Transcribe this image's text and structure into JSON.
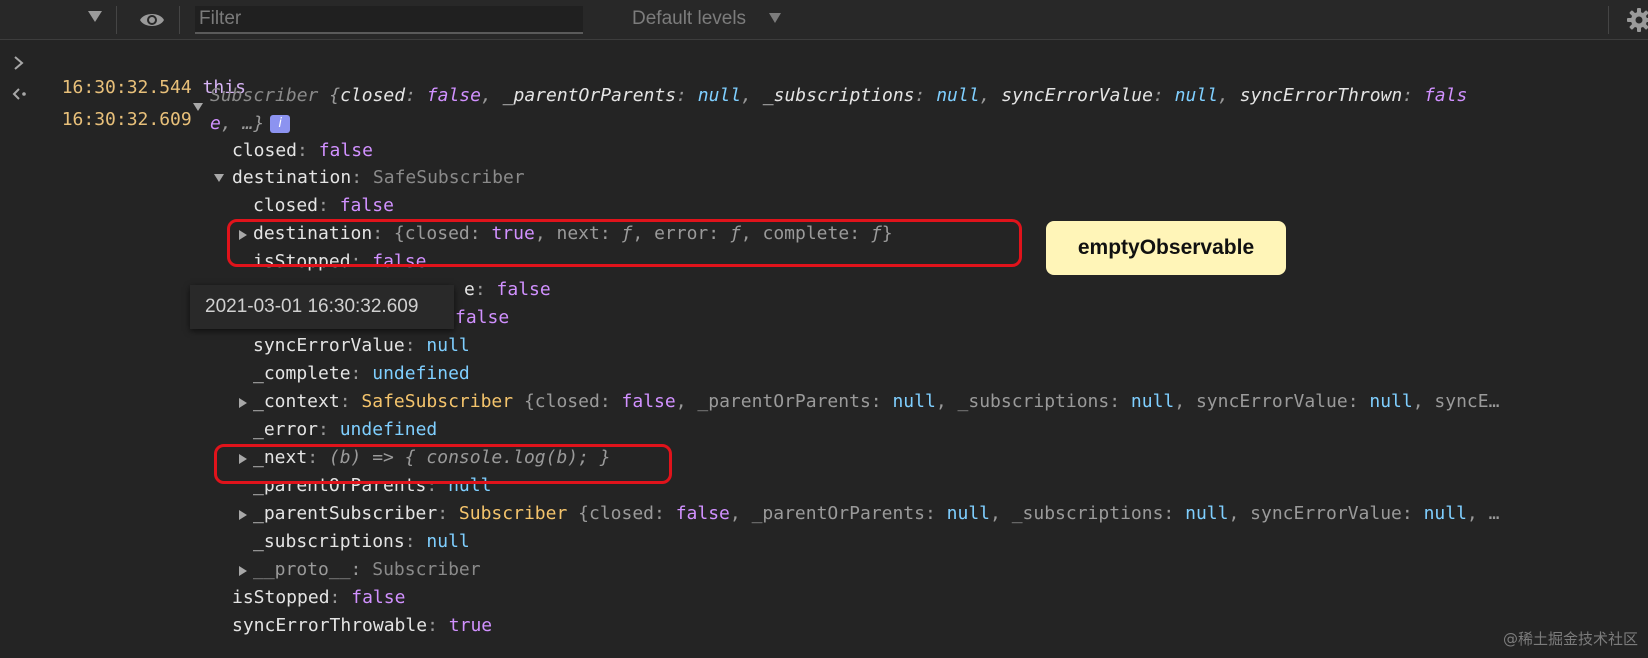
{
  "toolbar": {
    "filter_placeholder": "Filter",
    "levels_label": "Default levels",
    "icons": [
      "chevron-down-icon",
      "eye-icon",
      "gear-icon"
    ]
  },
  "entries": [
    {
      "direction": "input",
      "timestamp": "16:30:32.544",
      "text": "this"
    },
    {
      "direction": "output",
      "timestamp": "16:30:32.609"
    }
  ],
  "summary": {
    "class_name": "Subscriber",
    "open": " {",
    "props": [
      {
        "key": "closed",
        "value": "false"
      },
      {
        "key": "_parentOrParents",
        "value": "null"
      },
      {
        "key": "_subscriptions",
        "value": "null"
      },
      {
        "key": "syncErrorValue",
        "value": "null"
      },
      {
        "key": "syncErrorThrown",
        "value": "fals"
      }
    ],
    "wrap_value": "e",
    "tail": ", …}",
    "info_badge": "i"
  },
  "tree": {
    "closed": {
      "key": "closed",
      "value": "false"
    },
    "destination": {
      "key": "destination",
      "value": "SafeSubscriber"
    },
    "dest_closed": {
      "key": "closed",
      "value": "false"
    },
    "dest_destination": {
      "key": "destination",
      "props": [
        {
          "key": "closed",
          "value": "true"
        },
        {
          "key": "next",
          "value": "ƒ"
        },
        {
          "key": "error",
          "value": "ƒ"
        },
        {
          "key": "complete",
          "value": "ƒ"
        }
      ]
    },
    "dest_isStopped": {
      "key": "isStopped",
      "value": "false"
    },
    "dest_row_a": {
      "key_tail": "e",
      "value": "false"
    },
    "dest_row_b": {
      "value": "false"
    },
    "dest_syncErrorValue": {
      "key": "syncErrorValue",
      "value": "null"
    },
    "dest_complete": {
      "key": "_complete",
      "value": "undefined"
    },
    "dest_context": {
      "key": "_context",
      "class_name": "SafeSubscriber",
      "props": [
        {
          "key": "closed",
          "value": "false"
        },
        {
          "key": "_parentOrParents",
          "value": "null"
        },
        {
          "key": "_subscriptions",
          "value": "null"
        },
        {
          "key": "syncErrorValue",
          "value": "null"
        }
      ],
      "tail": ", syncE…"
    },
    "dest_error": {
      "key": "_error",
      "value": "undefined"
    },
    "dest_next": {
      "key": "_next",
      "value": "(b) => { console.log(b); }"
    },
    "dest_parentOrParents": {
      "key": "_parentOrParents",
      "value": "null"
    },
    "dest_parentSubscriber": {
      "key": "_parentSubscriber",
      "class_name": "Subscriber",
      "props": [
        {
          "key": "closed",
          "value": "false"
        },
        {
          "key": "_parentOrParents",
          "value": "null"
        },
        {
          "key": "_subscriptions",
          "value": "null"
        },
        {
          "key": "syncErrorValue",
          "value": "null"
        }
      ],
      "tail": ", …"
    },
    "dest_subscriptions": {
      "key": "_subscriptions",
      "value": "null"
    },
    "dest_proto": {
      "key": "__proto__",
      "value": "Subscriber"
    },
    "isStopped": {
      "key": "isStopped",
      "value": "false"
    },
    "syncErrorThrowable": {
      "key": "syncErrorThrowable",
      "value": "true"
    }
  },
  "callout_text": "emptyObservable",
  "tooltip_text": "2021-03-01 16:30:32.609",
  "watermark": "@稀土掘金技术社区",
  "colors": {
    "background": "#242424",
    "timestamp": "#e8c07a",
    "boolean": "#d191ff",
    "null": "#7fcfff",
    "class_name": "#f4c46c",
    "highlight": "#e0131b",
    "callout": "#fff5b8"
  }
}
